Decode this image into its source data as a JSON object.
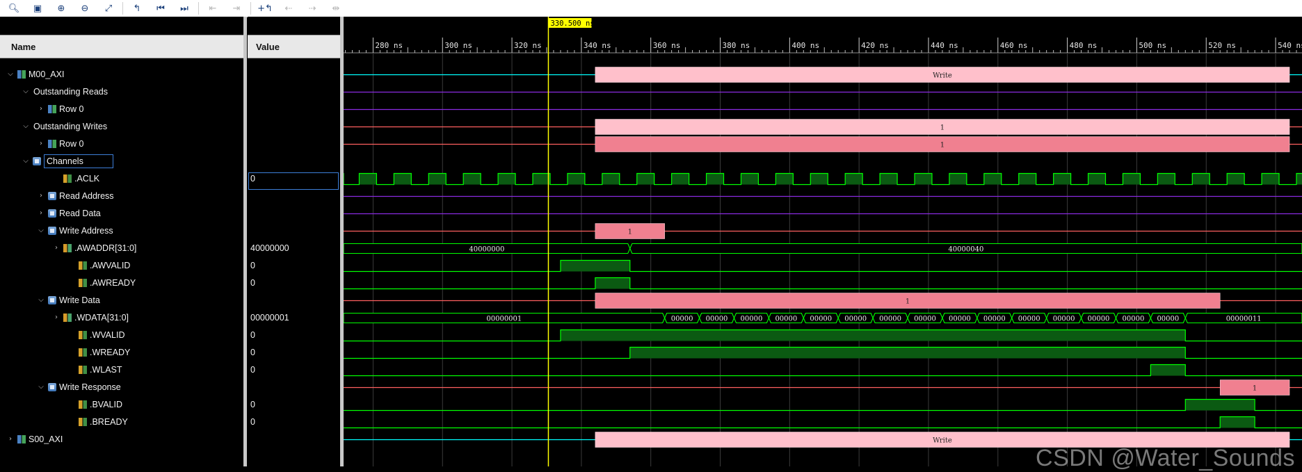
{
  "toolbar": {
    "buttons": [
      {
        "icon": "search-icon",
        "glyph": "🔍︎",
        "enabled": true
      },
      {
        "icon": "save-icon",
        "glyph": "▣",
        "enabled": true
      },
      {
        "icon": "zoom-in-icon",
        "glyph": "⊕",
        "enabled": true
      },
      {
        "icon": "zoom-out-icon",
        "glyph": "⊖",
        "enabled": true
      },
      {
        "icon": "zoom-fit-icon",
        "glyph": "⤢",
        "enabled": true
      },
      {
        "icon": "go-to-cursor-icon",
        "glyph": "↰",
        "enabled": true
      },
      {
        "icon": "go-to-time-0-icon",
        "glyph": "⏮",
        "enabled": true
      },
      {
        "icon": "go-to-last-time-icon",
        "glyph": "⏭",
        "enabled": true
      },
      {
        "icon": "previous-transition-icon",
        "glyph": "⇤",
        "enabled": false
      },
      {
        "icon": "next-transition-icon",
        "glyph": "⇥",
        "enabled": false
      },
      {
        "icon": "add-marker-icon",
        "glyph": "+↰",
        "enabled": true
      },
      {
        "icon": "previous-marker-icon",
        "glyph": "⇠",
        "enabled": false
      },
      {
        "icon": "next-marker-icon",
        "glyph": "⇢",
        "enabled": false
      },
      {
        "icon": "swap-cursors-icon",
        "glyph": "⇹",
        "enabled": false
      }
    ]
  },
  "columns": {
    "name": "Name",
    "value": "Value"
  },
  "cursor": {
    "label": "330.500 ns",
    "time_ns": 330.5,
    "color": "#ffff00"
  },
  "timeline": {
    "start_ns": 271.5,
    "end_ns": 547.6,
    "ticks": [
      "280 ns",
      "300 ns",
      "320 ns",
      "340 ns",
      "360 ns",
      "380 ns",
      "400 ns",
      "420 ns",
      "440 ns",
      "460 ns",
      "480 ns",
      "500 ns",
      "520 ns",
      "540 ns"
    ]
  },
  "colors": {
    "bit_high": "#00ff00",
    "bit_fill": "#0b5a12",
    "bus": "#00ff00",
    "txn_light": "#ffc0cb",
    "txn_dark": "#f08090",
    "grid": "#3b3b3b"
  },
  "rows": [
    {
      "label": "M00_AXI",
      "value": "",
      "indent": 0,
      "expander": "expanded",
      "icon": "iface",
      "wave": {
        "type": "txn",
        "line": "#00ffff",
        "segments": [
          {
            "start": 344,
            "end": 544,
            "text": "Write",
            "color": "light"
          }
        ]
      }
    },
    {
      "label": "Outstanding Reads",
      "value": "",
      "indent": 1,
      "expander": "expanded",
      "icon": "",
      "wave": {
        "type": "line",
        "line": "#8a2be2"
      }
    },
    {
      "label": "Row 0",
      "value": "",
      "indent": 2,
      "expander": "collapsed",
      "icon": "iface",
      "wave": {
        "type": "line",
        "line": "#8a2be2"
      }
    },
    {
      "label": "Outstanding Writes",
      "value": "",
      "indent": 1,
      "expander": "expanded",
      "icon": "",
      "wave": {
        "type": "txn",
        "line": "#ff6060",
        "segments": [
          {
            "start": 344,
            "end": 544,
            "text": "1",
            "color": "light"
          }
        ]
      }
    },
    {
      "label": "Row 0",
      "value": "",
      "indent": 2,
      "expander": "collapsed",
      "icon": "iface",
      "wave": {
        "type": "txn",
        "line": "#ff6060",
        "segments": [
          {
            "start": 344,
            "end": 544,
            "text": "1",
            "color": "dark"
          }
        ]
      }
    },
    {
      "label": "Channels",
      "value": "",
      "indent": 1,
      "expander": "expanded",
      "icon": "grp",
      "selected": true,
      "wave": {
        "type": "none"
      }
    },
    {
      "label": ".ACLK",
      "value": "0",
      "indent": 3,
      "expander": "",
      "icon": "bit",
      "wave": {
        "type": "clock",
        "period": 10,
        "first_rise": 276
      }
    },
    {
      "label": "Read Address",
      "value": "",
      "indent": 2,
      "expander": "collapsed",
      "icon": "grp",
      "wave": {
        "type": "line",
        "line": "#8a2be2"
      }
    },
    {
      "label": "Read Data",
      "value": "",
      "indent": 2,
      "expander": "collapsed",
      "icon": "grp",
      "wave": {
        "type": "line",
        "line": "#8a2be2"
      }
    },
    {
      "label": "Write Address",
      "value": "",
      "indent": 2,
      "expander": "expanded",
      "icon": "grp",
      "wave": {
        "type": "txn",
        "line": "#ff6060",
        "segments": [
          {
            "start": 344,
            "end": 364,
            "text": "1",
            "color": "dark"
          }
        ]
      }
    },
    {
      "label": ".AWADDR[31:0]",
      "value": "40000000",
      "indent": 3,
      "expander": "collapsed",
      "icon": "bus",
      "wave": {
        "type": "bus",
        "segments": [
          {
            "start": 271.5,
            "end": 354,
            "text": "40000000"
          },
          {
            "start": 354,
            "end": 547.6,
            "text": "40000040"
          }
        ]
      }
    },
    {
      "label": ".AWVALID",
      "value": "0",
      "indent": 4,
      "expander": "",
      "icon": "bit",
      "wave": {
        "type": "bit",
        "high": [
          [
            334,
            354
          ]
        ]
      }
    },
    {
      "label": ".AWREADY",
      "value": "0",
      "indent": 4,
      "expander": "",
      "icon": "bit",
      "wave": {
        "type": "bit",
        "high": [
          [
            344,
            354
          ]
        ]
      }
    },
    {
      "label": "Write Data",
      "value": "",
      "indent": 2,
      "expander": "expanded",
      "icon": "grp",
      "wave": {
        "type": "txn",
        "line": "#ff6060",
        "segments": [
          {
            "start": 344,
            "end": 524,
            "text": "1",
            "color": "dark"
          }
        ]
      }
    },
    {
      "label": ".WDATA[31:0]",
      "value": "00000001",
      "indent": 3,
      "expander": "collapsed",
      "icon": "bus",
      "wave": {
        "type": "bus",
        "segments": [
          {
            "start": 271.5,
            "end": 364,
            "text": "00000001"
          },
          {
            "start": 364,
            "end": 374,
            "text": "00000"
          },
          {
            "start": 374,
            "end": 384,
            "text": "00000"
          },
          {
            "start": 384,
            "end": 394,
            "text": "00000"
          },
          {
            "start": 394,
            "end": 404,
            "text": "00000"
          },
          {
            "start": 404,
            "end": 414,
            "text": "00000"
          },
          {
            "start": 414,
            "end": 424,
            "text": "00000"
          },
          {
            "start": 424,
            "end": 434,
            "text": "00000"
          },
          {
            "start": 434,
            "end": 444,
            "text": "00000"
          },
          {
            "start": 444,
            "end": 454,
            "text": "00000"
          },
          {
            "start": 454,
            "end": 464,
            "text": "00000"
          },
          {
            "start": 464,
            "end": 474,
            "text": "00000"
          },
          {
            "start": 474,
            "end": 484,
            "text": "00000"
          },
          {
            "start": 484,
            "end": 494,
            "text": "00000"
          },
          {
            "start": 494,
            "end": 504,
            "text": "00000"
          },
          {
            "start": 504,
            "end": 514,
            "text": "00000"
          },
          {
            "start": 514,
            "end": 547.6,
            "text": "00000011"
          }
        ]
      }
    },
    {
      "label": ".WVALID",
      "value": "0",
      "indent": 4,
      "expander": "",
      "icon": "bit",
      "wave": {
        "type": "bit",
        "high": [
          [
            334,
            514
          ]
        ]
      }
    },
    {
      "label": ".WREADY",
      "value": "0",
      "indent": 4,
      "expander": "",
      "icon": "bit",
      "wave": {
        "type": "bit",
        "high": [
          [
            354,
            514
          ]
        ]
      }
    },
    {
      "label": ".WLAST",
      "value": "0",
      "indent": 4,
      "expander": "",
      "icon": "bit",
      "wave": {
        "type": "bit",
        "high": [
          [
            504,
            514
          ]
        ]
      }
    },
    {
      "label": "Write Response",
      "value": "",
      "indent": 2,
      "expander": "expanded",
      "icon": "grp",
      "wave": {
        "type": "txn",
        "line": "#ff6060",
        "segments": [
          {
            "start": 524,
            "end": 544,
            "text": "1",
            "color": "dark"
          }
        ]
      }
    },
    {
      "label": ".BVALID",
      "value": "0",
      "indent": 4,
      "expander": "",
      "icon": "bit",
      "wave": {
        "type": "bit",
        "high": [
          [
            514,
            534
          ]
        ]
      }
    },
    {
      "label": ".BREADY",
      "value": "0",
      "indent": 4,
      "expander": "",
      "icon": "bit",
      "wave": {
        "type": "bit",
        "high": [
          [
            524,
            534
          ]
        ]
      }
    },
    {
      "label": "S00_AXI",
      "value": "",
      "indent": 0,
      "expander": "collapsed",
      "icon": "iface",
      "wave": {
        "type": "txn",
        "line": "#00ffff",
        "segments": [
          {
            "start": 344,
            "end": 544,
            "text": "Write",
            "color": "light"
          }
        ]
      }
    }
  ],
  "watermark": "CSDN @Water_Sounds"
}
